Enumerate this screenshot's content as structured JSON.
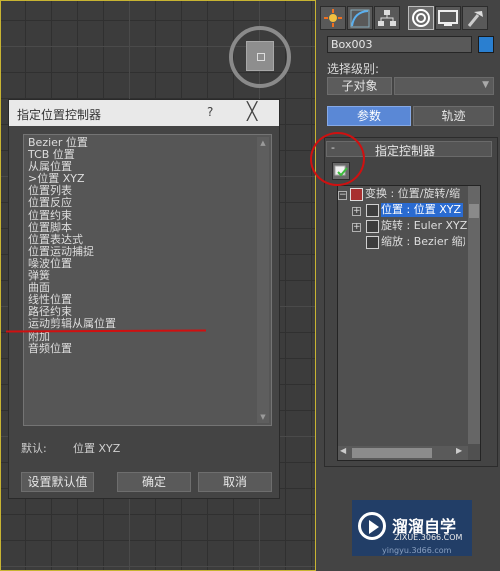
{
  "dialog": {
    "title": "指定位置控制器",
    "help": "?",
    "close": "╳",
    "list_items": [
      "Bezier 位置",
      "TCB 位置",
      "从属位置",
      ">位置 XYZ",
      "位置列表",
      "位置反应",
      "位置约束",
      "位置脚本",
      "位置表达式",
      "位置运动捕捉",
      "噪波位置",
      "弹簧",
      "曲面",
      "线性位置",
      "路径约束",
      "运动剪辑从属位置",
      "附加",
      "音频位置"
    ],
    "default_label": "默认:",
    "default_value": "位置 XYZ",
    "set_default_button": "设置默认值",
    "ok_button": "确定",
    "cancel_button": "取消"
  },
  "panel": {
    "object_name": "Box003",
    "color": "#2a7fd0",
    "selection_level_label": "选择级别:",
    "subobject_button": "子对象",
    "params_button": "参数",
    "motion_button": "轨迹",
    "rollout_minus": "-",
    "rollout_title": "指定控制器",
    "tree": {
      "root": "变换 : 位置/旋转/缩",
      "position": "位置 : 位置 XYZ",
      "rotation": "旋转 : Euler XYZ",
      "scale": "缩放 : Bezier 缩放"
    }
  },
  "watermark": {
    "title": "溜溜自学",
    "url": "ZIXUE.3066.COM",
    "url2": "yingyu.3d66.com"
  }
}
